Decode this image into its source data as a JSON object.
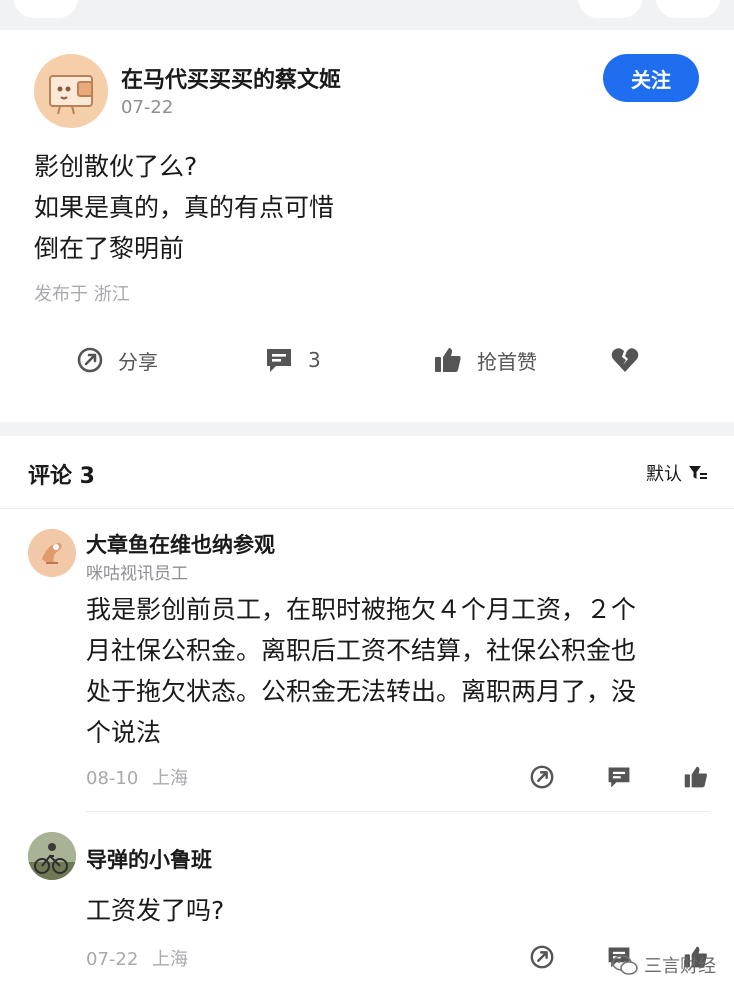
{
  "post": {
    "author": "在马代买买买的蔡文姬",
    "date": "07-22",
    "follow_label": "关注",
    "text_lines": [
      "影创散伙了么?",
      "如果是真的，真的有点可惜",
      "倒在了黎明前"
    ],
    "location": "发布于 浙江",
    "actions": {
      "share_label": "分享",
      "comment_count": "3",
      "like_label": "抢首赞",
      "share_icon": "share-icon",
      "comment_icon": "comment-icon",
      "like_icon": "thumbs-up-icon",
      "dislike_icon": "broken-heart-icon"
    }
  },
  "comments_section": {
    "title": "评论 3",
    "sort_label": "默认",
    "sort_icon": "filter-icon",
    "items": [
      {
        "name": "大章鱼在维也纳参观",
        "subtitle": "咪咕视讯员工",
        "text_lines": [
          "我是影创前员工，在职时被拖欠４个月工资，２个",
          "月社保公积金。离职后工资不结算，社保公积金也",
          "处于拖欠状态。公积金无法转出。离职两月了，没",
          "个说法"
        ],
        "date": "08-10",
        "location": "上海"
      },
      {
        "name": "导弹的小鲁班",
        "text_lines": [
          "工资发了吗?"
        ],
        "date": "07-22",
        "location": "上海"
      }
    ]
  },
  "watermark": "三言财经",
  "colors": {
    "accent": "#1f6ef0",
    "avatar_bg": "#f4cfaa"
  }
}
